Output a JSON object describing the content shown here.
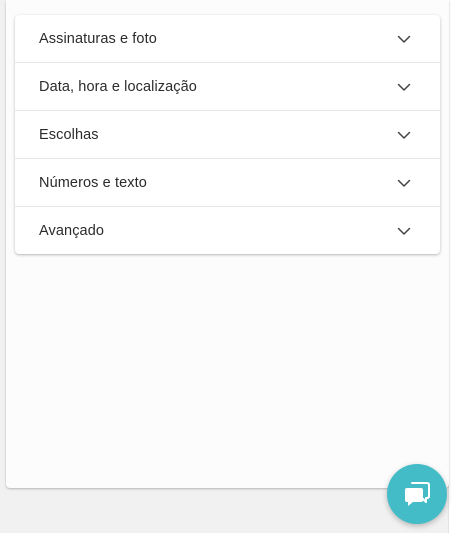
{
  "accordion": {
    "items": [
      {
        "label": "Assinaturas e foto",
        "icon": "chevron-down-icon"
      },
      {
        "label": "Data, hora e localização",
        "icon": "chevron-down-icon"
      },
      {
        "label": "Escolhas",
        "icon": "chevron-down-icon"
      },
      {
        "label": "Números e texto",
        "icon": "chevron-down-icon"
      },
      {
        "label": "Avançado",
        "icon": "chevron-down-icon"
      }
    ]
  },
  "chat": {
    "icon": "chat-bubble-icon",
    "color": "#44bcc8"
  },
  "colors": {
    "text": "#2b2b2b",
    "chevron": "#444444",
    "background": "#f1f1f1",
    "panel": "#fcfcfc"
  }
}
